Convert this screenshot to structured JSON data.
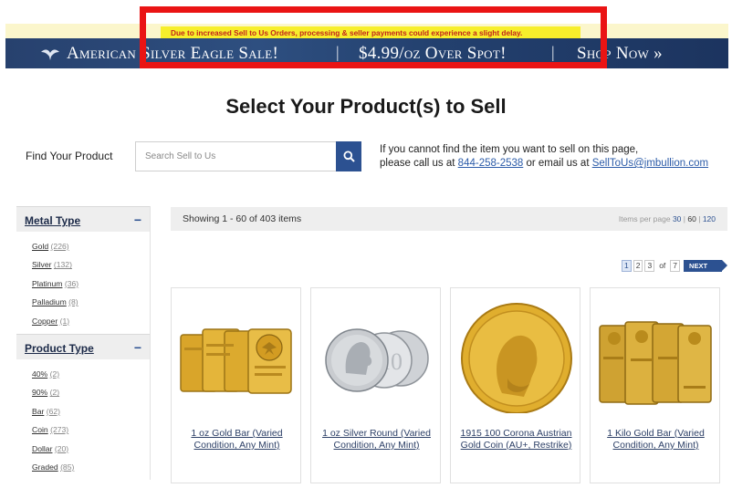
{
  "notice": {
    "text": "Due to increased Sell to Us Orders, processing & seller payments could experience a slight delay."
  },
  "banner": {
    "part1": "American Silver Eagle Sale!",
    "sep1": "|",
    "part2": "$4.99/oz Over Spot!",
    "sep2": "|",
    "part3": "Shop Now »",
    "color": "#27416e"
  },
  "page": {
    "title": "Select Your Product(s) to Sell"
  },
  "search": {
    "label": "Find Your Product",
    "placeholder": "Search Sell to Us",
    "value": "",
    "button_icon": "search-icon",
    "button_color": "#2c5191"
  },
  "contact": {
    "line1": "If you cannot find the item you want to sell on this page,",
    "line2_prefix": "please call us at ",
    "phone": "844-258-2538",
    "middle": " or email us at ",
    "email": "SellToUs@jmbullion.com"
  },
  "sidebar": {
    "facets": [
      {
        "title": "Metal Type",
        "toggle": "−",
        "items": [
          {
            "name": "Gold",
            "count": "(226)"
          },
          {
            "name": "Silver",
            "count": "(132)"
          },
          {
            "name": "Platinum",
            "count": "(36)"
          },
          {
            "name": "Palladium",
            "count": "(8)"
          },
          {
            "name": "Copper",
            "count": "(1)"
          }
        ]
      },
      {
        "title": "Product Type",
        "toggle": "−",
        "items": [
          {
            "name": "40%",
            "count": "(2)"
          },
          {
            "name": "90%",
            "count": "(2)"
          },
          {
            "name": "Bar",
            "count": "(62)"
          },
          {
            "name": "Coin",
            "count": "(273)"
          },
          {
            "name": "Dollar",
            "count": "(20)"
          },
          {
            "name": "Graded",
            "count": "(85)"
          }
        ]
      }
    ]
  },
  "results": {
    "showing": "Showing 1 - 60 of 403 items",
    "per_page_label": "Items per page",
    "per_page_options": [
      "30",
      "60",
      "120"
    ],
    "per_page_sep": "|"
  },
  "pagination": {
    "pages": [
      "1",
      "2",
      "3"
    ],
    "of_label": "of",
    "total": "7",
    "next_label": "NEXT",
    "current": "1"
  },
  "products": [
    {
      "line1": "1 oz Gold Bar (Varied",
      "line2": "Condition, Any Mint)",
      "image": "gold-bars-image"
    },
    {
      "line1": "1 oz Silver Round (Varied",
      "line2": "Condition, Any Mint)",
      "image": "silver-rounds-image"
    },
    {
      "line1": "1915 100 Corona Austrian",
      "line2": "Gold Coin (AU+, Restrike)",
      "image": "gold-coin-image"
    },
    {
      "line1": "1 Kilo Gold Bar (Varied",
      "line2": "Condition, Any Mint)",
      "image": "kilo-gold-bars-image"
    }
  ],
  "colors": {
    "accent": "#2c5191",
    "highlight_border": "#ea1414",
    "notice_text": "#c2241c"
  }
}
